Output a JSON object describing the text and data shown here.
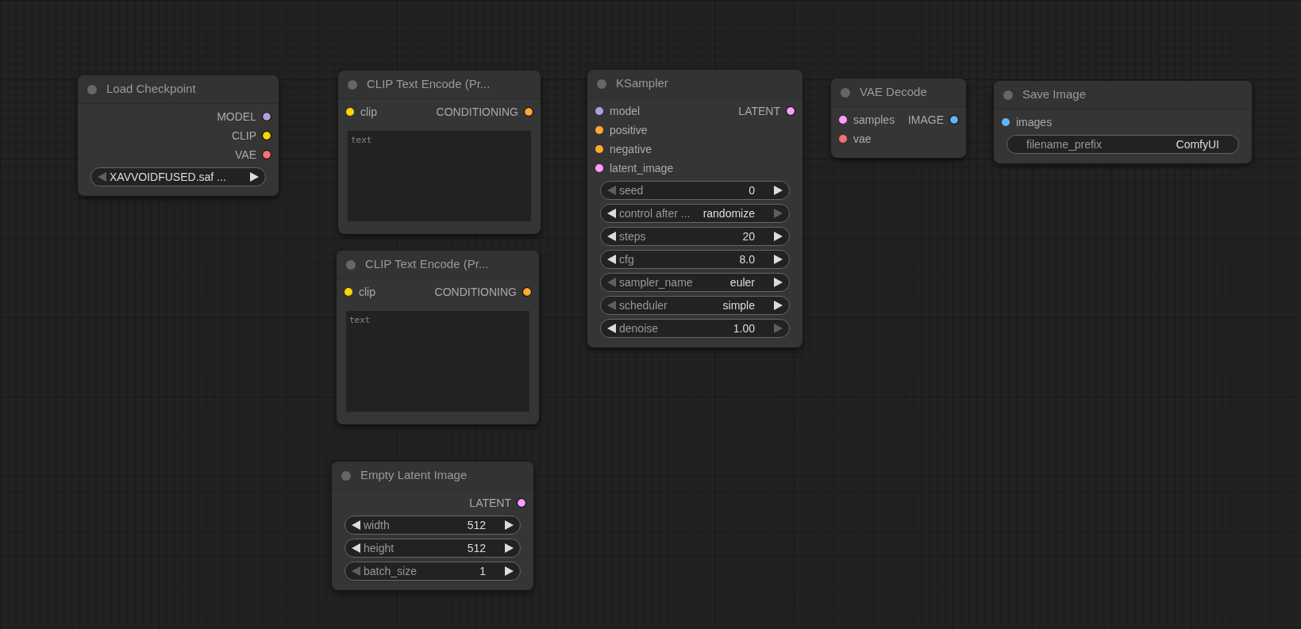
{
  "nodes": [
    {
      "title": "Load Checkpoint",
      "outputs": [
        {
          "label": "MODEL",
          "color": "#b39ddb"
        },
        {
          "label": "CLIP",
          "color": "#ffd500"
        },
        {
          "label": "VAE",
          "color": "#ff6e6e"
        }
      ],
      "widgets": [
        {
          "kind": "combo",
          "value": "XAVVOIDFUSED.saf ...",
          "left_disabled": true,
          "right_disabled": false
        }
      ]
    },
    {
      "title": "CLIP Text Encode (Pr...",
      "inputs": [
        {
          "label": "clip",
          "color": "#ffd500"
        }
      ],
      "outputs": [
        {
          "label": "CONDITIONING",
          "color": "#ffa931"
        }
      ],
      "widgets": [
        {
          "kind": "textarea",
          "placeholder": "text"
        }
      ]
    },
    {
      "title": "CLIP Text Encode (Pr...",
      "inputs": [
        {
          "label": "clip",
          "color": "#ffd500"
        }
      ],
      "outputs": [
        {
          "label": "CONDITIONING",
          "color": "#ffa931"
        }
      ],
      "widgets": [
        {
          "kind": "textarea",
          "placeholder": "text"
        }
      ]
    },
    {
      "title": "Empty Latent Image",
      "outputs": [
        {
          "label": "LATENT",
          "color": "#ff9cf9"
        }
      ],
      "widgets": [
        {
          "kind": "number",
          "label": "width",
          "value": "512",
          "left_disabled": false,
          "right_disabled": false
        },
        {
          "kind": "number",
          "label": "height",
          "value": "512",
          "left_disabled": false,
          "right_disabled": false
        },
        {
          "kind": "number",
          "label": "batch_size",
          "value": "1",
          "left_disabled": true,
          "right_disabled": false
        }
      ]
    },
    {
      "title": "KSampler",
      "inputs": [
        {
          "label": "model",
          "color": "#b39ddb"
        },
        {
          "label": "positive",
          "color": "#ffa931"
        },
        {
          "label": "negative",
          "color": "#ffa931"
        },
        {
          "label": "latent_image",
          "color": "#ff9cf9"
        }
      ],
      "outputs": [
        {
          "label": "LATENT",
          "color": "#ff9cf9"
        }
      ],
      "widgets": [
        {
          "kind": "number",
          "label": "seed",
          "value": "0",
          "left_disabled": true,
          "right_disabled": false
        },
        {
          "kind": "combo",
          "label": "control after ...",
          "value": "randomize",
          "left_disabled": false,
          "right_disabled": true
        },
        {
          "kind": "number",
          "label": "steps",
          "value": "20",
          "left_disabled": false,
          "right_disabled": false
        },
        {
          "kind": "number",
          "label": "cfg",
          "value": "8.0",
          "left_disabled": false,
          "right_disabled": false
        },
        {
          "kind": "combo",
          "label": "sampler_name",
          "value": "euler",
          "left_disabled": true,
          "right_disabled": false
        },
        {
          "kind": "combo",
          "label": "scheduler",
          "value": "simple",
          "left_disabled": true,
          "right_disabled": false
        },
        {
          "kind": "number",
          "label": "denoise",
          "value": "1.00",
          "left_disabled": false,
          "right_disabled": true
        }
      ]
    },
    {
      "title": "VAE Decode",
      "inputs": [
        {
          "label": "samples",
          "color": "#ff9cf9"
        },
        {
          "label": "vae",
          "color": "#ff6e6e"
        }
      ],
      "outputs": [
        {
          "label": "IMAGE",
          "color": "#64b5f6"
        }
      ]
    },
    {
      "title": "Save Image",
      "inputs": [
        {
          "label": "images",
          "color": "#64b5f6"
        }
      ],
      "widgets": [
        {
          "kind": "text",
          "label": "filename_prefix",
          "value": "ComfyUI"
        }
      ]
    }
  ]
}
